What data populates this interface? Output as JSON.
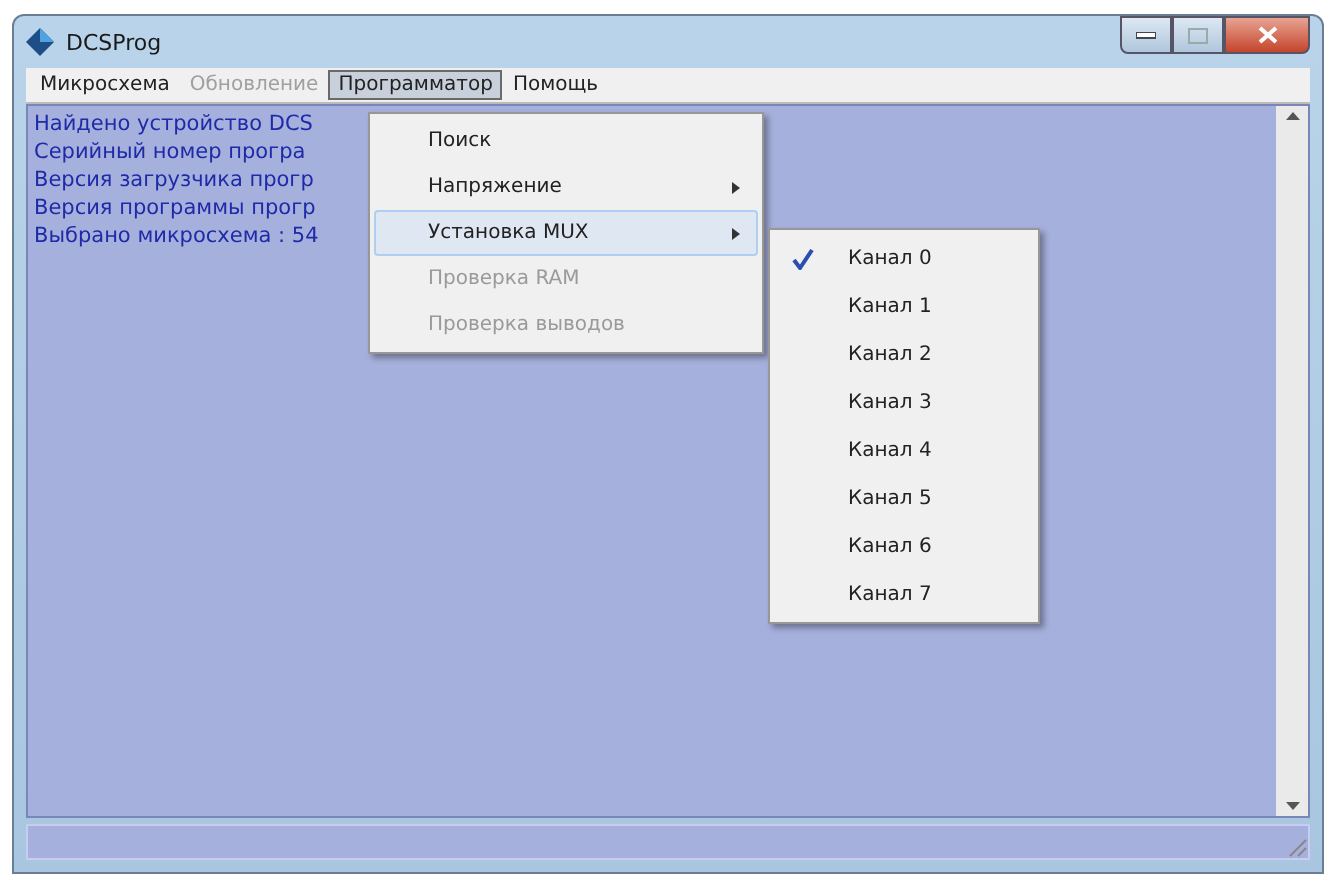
{
  "window": {
    "title": "DCSProg"
  },
  "menubar": [
    {
      "label": "Микросхема",
      "selected": false,
      "disabled": false
    },
    {
      "label": "Обновление",
      "selected": false,
      "disabled": true
    },
    {
      "label": "Программатор",
      "selected": true,
      "disabled": false
    },
    {
      "label": "Помощь",
      "selected": false,
      "disabled": false
    }
  ],
  "log": [
    "Найдено устройство DCS",
    "Серийный номер програ",
    "Версия загрузчика прогр",
    "Версия программы прогр",
    "Выбрано микросхема : 54"
  ],
  "menu": [
    {
      "label": "Поиск",
      "selected": false,
      "disabled": false,
      "submenu": false
    },
    {
      "label": "Напряжение",
      "selected": false,
      "disabled": false,
      "submenu": true
    },
    {
      "label": "Установка MUX",
      "selected": true,
      "disabled": false,
      "submenu": true
    },
    {
      "label": "Проверка RAM",
      "selected": false,
      "disabled": true,
      "submenu": false
    },
    {
      "label": "Проверка выводов",
      "selected": false,
      "disabled": true,
      "submenu": false
    }
  ],
  "submenu": [
    {
      "label": "Канал 0",
      "checked": true
    },
    {
      "label": "Канал 1",
      "checked": false
    },
    {
      "label": "Канал 2",
      "checked": false
    },
    {
      "label": "Канал 3",
      "checked": false
    },
    {
      "label": "Канал 4",
      "checked": false
    },
    {
      "label": "Канал 5",
      "checked": false
    },
    {
      "label": "Канал 6",
      "checked": false
    },
    {
      "label": "Канал 7",
      "checked": false
    }
  ]
}
